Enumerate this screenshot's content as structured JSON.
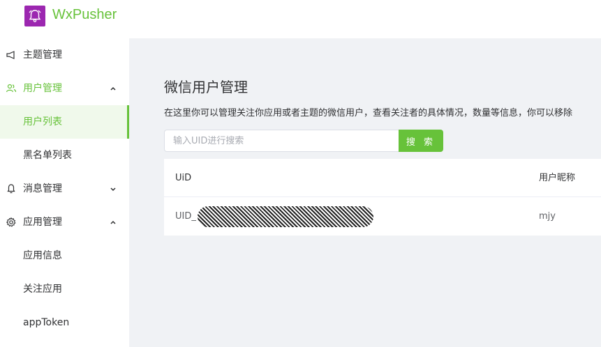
{
  "header": {
    "brand": "WxPusher"
  },
  "sidebar": {
    "items": [
      {
        "label": "主题管理",
        "icon": "megaphone-icon"
      },
      {
        "label": "用户管理",
        "icon": "users-icon"
      },
      {
        "label": "用户列表"
      },
      {
        "label": "黑名单列表"
      },
      {
        "label": "消息管理",
        "icon": "bell-icon"
      },
      {
        "label": "应用管理",
        "icon": "gear-icon"
      },
      {
        "label": "应用信息"
      },
      {
        "label": "关注应用"
      },
      {
        "label": "appToken"
      }
    ]
  },
  "main": {
    "title": "微信用户管理",
    "description": "在这里你可以管理关注你应用或者主题的微信用户，查看关注者的具体情况，数量等信息，你可以移除",
    "search": {
      "placeholder": "输入UID进行搜索",
      "button_label": "搜 索"
    },
    "table": {
      "columns": [
        "UiD",
        "用户昵称"
      ],
      "rows": [
        {
          "uid": "UID_",
          "nickname": "mjy"
        }
      ]
    }
  },
  "colors": {
    "accent": "#67c23a",
    "logo": "#9c27b0",
    "main_bg": "#f0f2f5"
  }
}
